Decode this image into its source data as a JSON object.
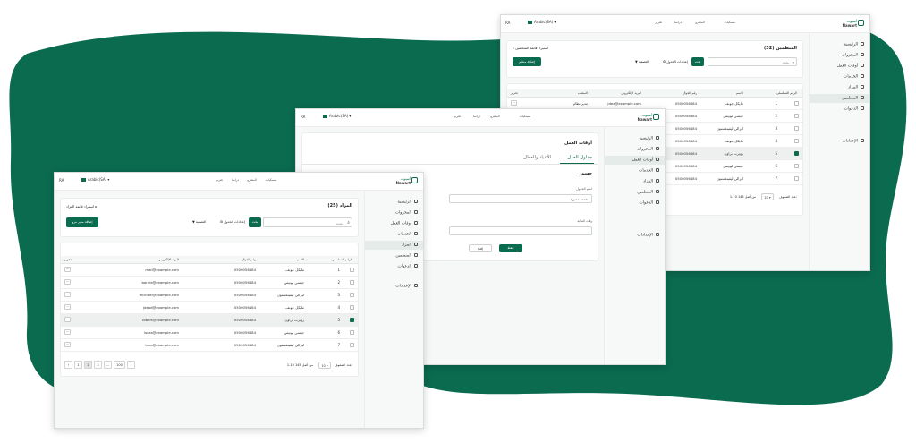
{
  "brand": {
    "name_ar": "أسيوت",
    "name_en": "Nawart",
    "green": "#0a6b4f",
    "accent": "#0e7a59"
  },
  "topbar": {
    "nav": [
      "مسكيات",
      "المشرو",
      "دراسا",
      "تقرير"
    ],
    "language": "Arabic(SA)",
    "user_initials": "RA"
  },
  "sidebar": {
    "items": [
      {
        "label": "الرئيسية",
        "icon": "home-icon"
      },
      {
        "label": "المحروات",
        "icon": "document-icon"
      },
      {
        "label": "أوقات العمل",
        "icon": "clock-icon"
      },
      {
        "label": "الخدمات",
        "icon": "services-icon"
      },
      {
        "label": "المزاد",
        "icon": "hierarchy-icon"
      },
      {
        "label": "المنظمين",
        "icon": "users-icon"
      },
      {
        "label": "الدعوات",
        "icon": "invite-icon"
      },
      {
        "label": "الإعدادات",
        "icon": "gear-icon"
      }
    ]
  },
  "front": {
    "title": "المزاد (25)",
    "import_label": "استيراد قائمة المزاد",
    "add_label": "إضافة مدير مزو",
    "search_placeholder": "بحث",
    "search_button": "بحث",
    "filter_label": "التصفية",
    "columns_label": "إعدادات الجدول",
    "headers": [
      "الرقم التسلسلي",
      "الاسم",
      "رقم الجوال",
      "البريد الإلكتروني",
      "تحرير"
    ],
    "rows": [
      {
        "num": "1",
        "name": "مايكل جونف",
        "phone": "0500056484",
        "email": "mail@example.com",
        "selected": false
      },
      {
        "num": "2",
        "name": "جيسي لوبيس",
        "phone": "0500056484",
        "email": "bornie@example.com",
        "selected": false
      },
      {
        "num": "3",
        "name": "ليزالي ليفينغستون",
        "phone": "0500056484",
        "email": "michael@example.com",
        "selected": false
      },
      {
        "num": "4",
        "name": "مايكل جونف",
        "phone": "0500056484",
        "email": "jdead@example.com",
        "selected": false
      },
      {
        "num": "5",
        "name": "روبرت براون",
        "phone": "0500056484",
        "email": "robert@example.com",
        "selected": true
      },
      {
        "num": "6",
        "name": "جيسي لوبيس",
        "phone": "0500056484",
        "email": "lucas@example.com",
        "selected": false
      },
      {
        "num": "7",
        "name": "ليزالي ليفينغستون",
        "phone": "0500056484",
        "email": "lana@example.com",
        "selected": false
      }
    ],
    "pagination": {
      "rows_label": "عدد الصفوف:",
      "rows_value": "10",
      "range": "1-10 من أصل 145",
      "pages": [
        "‹",
        "1",
        "2",
        "3",
        "...",
        "100",
        "›"
      ]
    }
  },
  "middle": {
    "title": "أوقات العمل",
    "tabs": [
      "جداول العمل",
      "الأعياد والعطل"
    ],
    "subtitle": "حسور",
    "field1_label": "اسم الجدول",
    "field1_value": "خدمة مميزة",
    "field2_label": "اسم الخيار",
    "field2_value": "me Service",
    "field3_label": "وقت البداية",
    "field4_label": "وقت النهاية",
    "save_label": "حفظ",
    "cancel_label": "إلغاء"
  },
  "back": {
    "title": "المنظمين (32)",
    "import_label": "استيراد قائمة المنظمين",
    "add_label": "إضافة منظم",
    "search_placeholder": "بحث",
    "search_button": "بحث",
    "filter_label": "التصفية",
    "columns_label": "إعدادات الجدول",
    "headers": [
      "الرقم التسلسلي",
      "الاسم",
      "رقم الجوال",
      "البريد الإلكتروني",
      "المنصب",
      "تحرير"
    ],
    "rows": [
      {
        "num": "1",
        "name": "مايكل جونف",
        "phone": "0500056484",
        "email": "jdea@example.com",
        "role": "مدير نظام",
        "selected": false
      },
      {
        "num": "2",
        "name": "جيسي لوبيس",
        "phone": "0500056484",
        "selected": false
      },
      {
        "num": "3",
        "name": "ليزالي ليفينغستون",
        "phone": "0500056484",
        "selected": false
      },
      {
        "num": "4",
        "name": "مايكل جونف",
        "phone": "0500056484",
        "selected": false
      },
      {
        "num": "5",
        "name": "روبرت براون",
        "phone": "0500056484",
        "selected": true
      },
      {
        "num": "6",
        "name": "جيسي لوبيس",
        "phone": "0500056484",
        "selected": false
      },
      {
        "num": "7",
        "name": "ليزالي ليفينغستون",
        "phone": "0500056484",
        "selected": false
      }
    ],
    "pagination": {
      "rows_label": "عدد الصفوف:",
      "rows_value": "10",
      "range": "1-10 من أصل 145"
    }
  }
}
